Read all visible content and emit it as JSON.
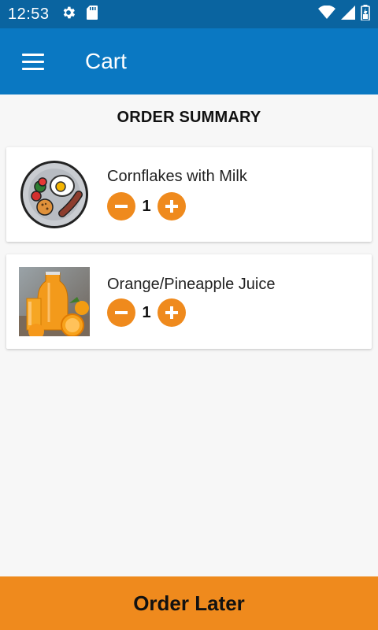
{
  "status_bar": {
    "time": "12:53",
    "icons": [
      "gear-icon",
      "sd-card-icon",
      "wifi-icon",
      "signal-icon",
      "battery-icon"
    ]
  },
  "app_bar": {
    "title": "Cart",
    "menu_icon": "hamburger-menu-icon"
  },
  "section_title": "ORDER SUMMARY",
  "cart": {
    "items": [
      {
        "name": "Cornflakes with Milk",
        "quantity": "1",
        "thumbnail": "breakfast-plate-icon"
      },
      {
        "name": "Orange/Pineapple Juice",
        "quantity": "1",
        "thumbnail": "orange-juice-photo"
      }
    ]
  },
  "footer": {
    "order_later_label": "Order Later"
  },
  "colors": {
    "status_bar": "#0a64a0",
    "app_bar": "#0a78c2",
    "accent": "#ef8a1d",
    "background": "#f7f7f7"
  }
}
